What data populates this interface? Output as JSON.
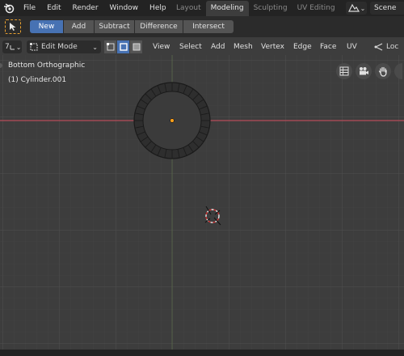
{
  "menu": [
    "File",
    "Edit",
    "Render",
    "Window",
    "Help"
  ],
  "workspace_tabs": [
    {
      "label": "Layout",
      "active": false
    },
    {
      "label": "Modeling",
      "active": true
    },
    {
      "label": "Sculpting",
      "active": false
    },
    {
      "label": "UV Editing",
      "active": false
    }
  ],
  "scene": {
    "label": "Scene"
  },
  "tool_settings": {
    "modes": [
      "New",
      "Add",
      "Subtract",
      "Difference",
      "Intersect"
    ],
    "active_mode": "New"
  },
  "viewport_header": {
    "editor_type": "7",
    "mode": "Edit Mode",
    "menus": [
      "View",
      "Select",
      "Add",
      "Mesh",
      "Vertex",
      "Edge",
      "Face",
      "UV"
    ],
    "overflow_label": "Loc"
  },
  "viewport": {
    "view_name": "Bottom Orthographic",
    "object_name": "(1) Cylinder.001"
  },
  "colors": {
    "x_axis": "#b54c5a",
    "active_tab": "#4772b3",
    "origin": "#ff9f1a"
  },
  "icons": {
    "nav": [
      "grid-view-icon",
      "camera-icon",
      "hand-pan-icon",
      "zoom-icon"
    ]
  }
}
